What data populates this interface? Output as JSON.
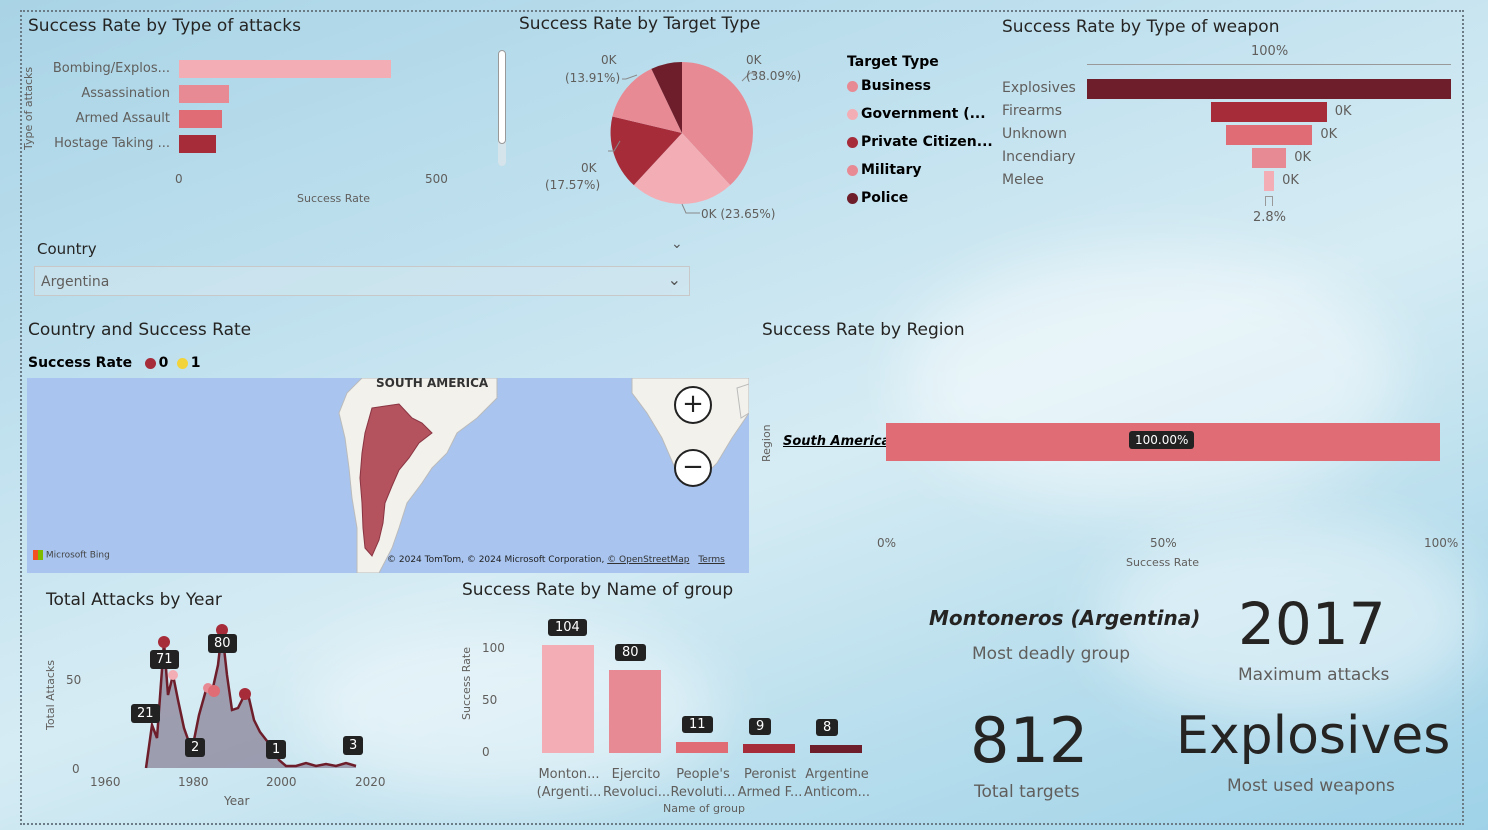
{
  "attacks": {
    "title": "Success Rate by Type of attacks",
    "ylabel": "Type of attacks",
    "xlabel": "Success Rate",
    "ticks": [
      "0",
      "500"
    ],
    "categories": [
      "Bombing/Explos...",
      "Assassination",
      "Armed Assault",
      "Hostage Taking ..."
    ],
    "values": [
      415,
      97,
      84,
      72
    ],
    "colors": [
      "#f3aeb5",
      "#e88a94",
      "#e06c76",
      "#a62c3a"
    ]
  },
  "target": {
    "title": "Success Rate by Target Type",
    "legend_title": "Target Type",
    "legend": [
      {
        "label": "Business",
        "color": "#e88a94"
      },
      {
        "label": "Government (...",
        "color": "#f3aeb5"
      },
      {
        "label": "Private Citizen...",
        "color": "#a62c3a"
      },
      {
        "label": "Military",
        "color": "#e88a94"
      },
      {
        "label": "Police",
        "color": "#6e1e2a"
      }
    ],
    "slice_labels": [
      "0K",
      "(38.09%)",
      "0K (23.65%)",
      "0K",
      "(17.57%)",
      "0K",
      "(13.91%)"
    ]
  },
  "weapon": {
    "title": "Success Rate by Type of weapon",
    "top_label": "100%",
    "bottom_label": "2.8%",
    "categories": [
      "Explosives",
      "Firearms",
      "Unknown",
      "Incendiary",
      "Melee"
    ],
    "data_labels": [
      "",
      "0K",
      "0K",
      "0K",
      "0K"
    ],
    "values": [
      100,
      31.7,
      23.8,
      9.5,
      2.8
    ],
    "colors": [
      "#6e1e2a",
      "#a62c3a",
      "#e06c76",
      "#e88a94",
      "#f3aeb5"
    ]
  },
  "country": {
    "label": "Country",
    "selected": "Argentina"
  },
  "map": {
    "title": "Country and Success Rate",
    "legend_title": "Success Rate",
    "legend_items": [
      {
        "label": "0",
        "color": "#a62c3a"
      },
      {
        "label": "1",
        "color": "#f2d33a"
      }
    ],
    "place_label": "SOUTH AMERICA",
    "brand": "Microsoft Bing",
    "copyright": "© 2024 TomTom, © 2024 Microsoft Corporation,",
    "osm": "© OpenStreetMap",
    "terms": "Terms"
  },
  "region": {
    "title": "Success Rate by Region",
    "ylabel": "Region",
    "xlabel": "Success Rate",
    "category": "South America",
    "value_label": "100.00%",
    "value": 100,
    "ticks": [
      "0%",
      "50%",
      "100%"
    ]
  },
  "years": {
    "title": "Total Attacks by Year",
    "ylabel": "Total Attacks",
    "xlabel": "Year",
    "yticks": [
      "0",
      "50"
    ],
    "xticks": [
      "1960",
      "1980",
      "2000",
      "2020"
    ],
    "labels": [
      {
        "text": "71"
      },
      {
        "text": "80"
      },
      {
        "text": "21"
      },
      {
        "text": "2"
      },
      {
        "text": "1"
      },
      {
        "text": "3"
      }
    ]
  },
  "groups": {
    "title": "Success Rate by Name of group",
    "ylabel": "Success Rate",
    "xlabel": "Name of group",
    "yticks": [
      "0",
      "50",
      "100"
    ],
    "categories": [
      [
        "Monton...",
        "(Argenti..."
      ],
      [
        "Ejercito",
        "Revoluci..."
      ],
      [
        "People's",
        "Revoluti..."
      ],
      [
        "Peronist",
        "Armed F..."
      ],
      [
        "Argentine",
        "Anticom..."
      ]
    ],
    "values": [
      104,
      80,
      11,
      9,
      8
    ],
    "data_labels": [
      "104",
      "80",
      "11",
      "9",
      "8"
    ],
    "colors": [
      "#f3aeb5",
      "#e88a94",
      "#e06c76",
      "#a62c3a",
      "#6e1e2a"
    ]
  },
  "kpis": {
    "group_name": "Montoneros (Argentina)",
    "group_label": "Most deadly group",
    "max_attacks": "2017",
    "max_attacks_label": "Maximum attacks",
    "targets": "812",
    "targets_label": "Total targets",
    "weapon": "Explosives",
    "weapon_label": "Most used weapons"
  }
}
